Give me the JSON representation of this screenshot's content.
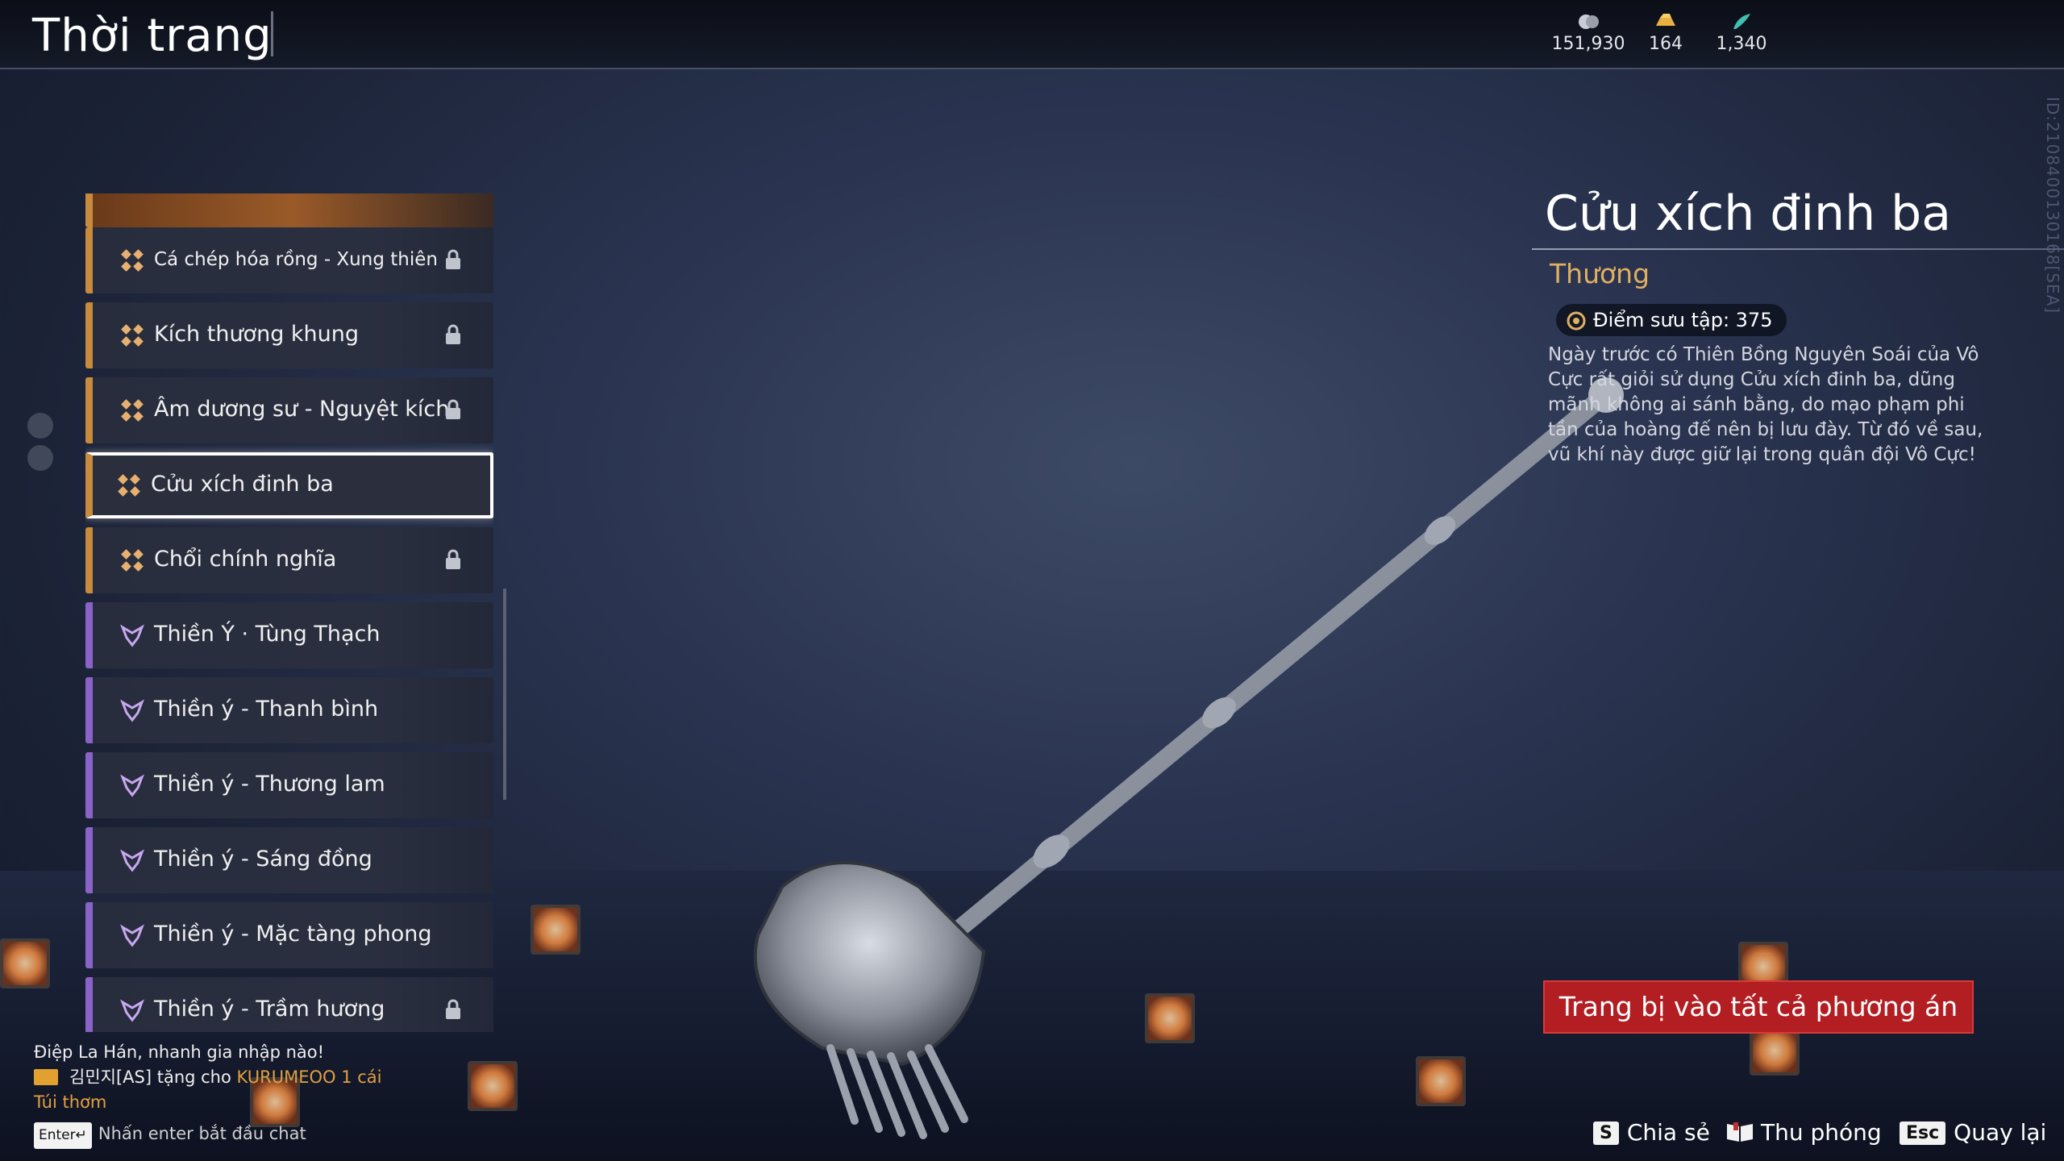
{
  "header": {
    "title": "Thời trang",
    "currencies": [
      {
        "icon": "coin-icon",
        "value": "151,930"
      },
      {
        "icon": "gold-ingot-icon",
        "value": "164"
      },
      {
        "icon": "jade-feather-icon",
        "value": "1,340"
      }
    ]
  },
  "build_id": "ID:2108400130168[SEA]",
  "list": {
    "items": [
      {
        "label": "Cá chép hóa rồng - Xung thiên",
        "rarity": "orange",
        "locked": true
      },
      {
        "label": "Kích thương khung",
        "rarity": "orange",
        "locked": true
      },
      {
        "label": "Âm dương sư - Nguyệt kích",
        "rarity": "orange",
        "locked": true
      },
      {
        "label": "Cửu xích đinh ba",
        "rarity": "orange",
        "locked": false,
        "selected": true
      },
      {
        "label": "Chổi chính nghĩa",
        "rarity": "orange",
        "locked": true
      },
      {
        "label": "Thiền Ý · Tùng Thạch",
        "rarity": "purple",
        "locked": false
      },
      {
        "label": "Thiền ý - Thanh bình",
        "rarity": "purple",
        "locked": false
      },
      {
        "label": "Thiền ý - Thương lam",
        "rarity": "purple",
        "locked": false
      },
      {
        "label": "Thiền ý - Sáng đồng",
        "rarity": "purple",
        "locked": false
      },
      {
        "label": "Thiền ý - Mặc tàng phong",
        "rarity": "purple",
        "locked": false
      },
      {
        "label": "Thiền ý - Trầm hương",
        "rarity": "purple",
        "locked": true
      }
    ]
  },
  "detail": {
    "name": "Cửu xích đinh ba",
    "rarity_label": "Thương",
    "collection_points": "Điểm sưu tập: 375",
    "description": "Ngày trước có Thiên Bồng Nguyên Soái của Vô Cực rất giỏi sử dụng Cửu xích đinh ba, dũng mãnh không ai sánh bằng, do mạo phạm phi tần của hoàng đế nên bị lưu đày. Từ đó về sau, vũ khí này được giữ lại trong quân đội Vô Cực!",
    "equip_button": "Trang bị vào tất cả phương án"
  },
  "chat": {
    "line1": "Điệp La Hán, nhanh gia nhập nào!",
    "line2_user": "김민지[AS] tặng cho",
    "line2_target": "KURUMEOO 1 cái",
    "line3": "Túi thơm",
    "hint_key": "Enter↵",
    "hint_text": "Nhấn enter bắt đầu chat"
  },
  "footer": {
    "share": {
      "key": "S",
      "label": "Chia sẻ"
    },
    "zoom": {
      "label": "Thu phóng"
    },
    "back": {
      "key": "Esc",
      "label": "Quay lại"
    }
  },
  "colors": {
    "orange_rarity": "#c88a3c",
    "purple_rarity": "#8a63c8",
    "equip_button": "#b21e22",
    "rarity_text": "#e0b060"
  }
}
